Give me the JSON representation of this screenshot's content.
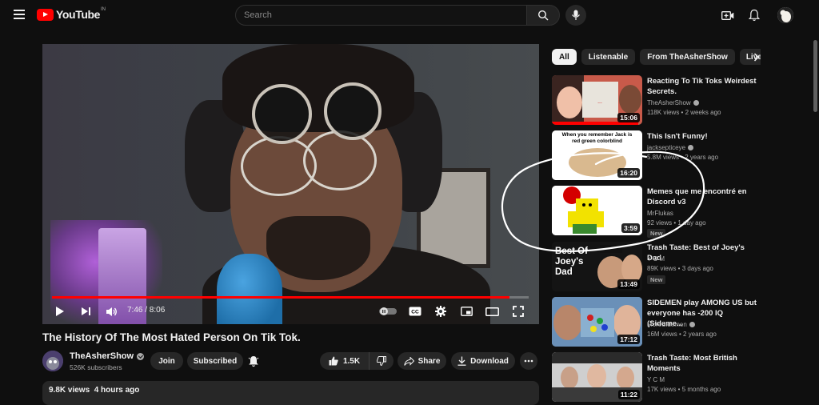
{
  "header": {
    "logo_text": "YouTube",
    "logo_country": "IN",
    "search_placeholder": "Search"
  },
  "player": {
    "time_display": "7:46 / 8:06",
    "progress_fraction": 0.96
  },
  "video": {
    "title": "The History Of The Most Hated Person On Tik Tok.",
    "channel_name": "TheAsherShow",
    "subscribers": "526K subscribers",
    "join_label": "Join",
    "subscribed_label": "Subscribed",
    "like_count": "1.5K",
    "share_label": "Share",
    "download_label": "Download",
    "views": "9.8K views",
    "age": "4 hours ago"
  },
  "chips": [
    "All",
    "Listenable",
    "From TheAsherShow",
    "Live"
  ],
  "recommendations": [
    {
      "title": "Reacting To Tik Toks Weirdest Secrets.",
      "channel": "TheAsherShow",
      "verified": true,
      "meta": "118K views • 2 weeks ago",
      "duration": "15:06",
      "badge": ""
    },
    {
      "title": "This Isn't Funny!",
      "channel": "jacksepticeye",
      "verified": true,
      "meta": "5.8M views • 2 years ago",
      "duration": "16:20",
      "badge": "",
      "thumb_text": "When you remember Jack is red green colorblind"
    },
    {
      "title": "Memes que me encontré en Discord v3",
      "channel": "MrFlukas",
      "verified": false,
      "meta": "92 views • 1 day ago",
      "duration": "3:59",
      "badge": "New"
    },
    {
      "title": "Trash Taste: Best of Joey's Dad",
      "channel": "Y C M",
      "verified": false,
      "meta": "89K views • 3 days ago",
      "duration": "13:49",
      "badge": "New",
      "thumb_text": "Best Of Joey's Dad"
    },
    {
      "title": "SIDEMEN play AMONG US but everyone has -200 IQ (Sideme...",
      "channel": "MoreSidemen",
      "verified": true,
      "meta": "16M views • 2 years ago",
      "duration": "17:12",
      "badge": ""
    },
    {
      "title": "Trash Taste: Most British Moments",
      "channel": "Y C M",
      "verified": false,
      "meta": "17K views • 5 months ago",
      "duration": "11:22",
      "badge": ""
    }
  ]
}
